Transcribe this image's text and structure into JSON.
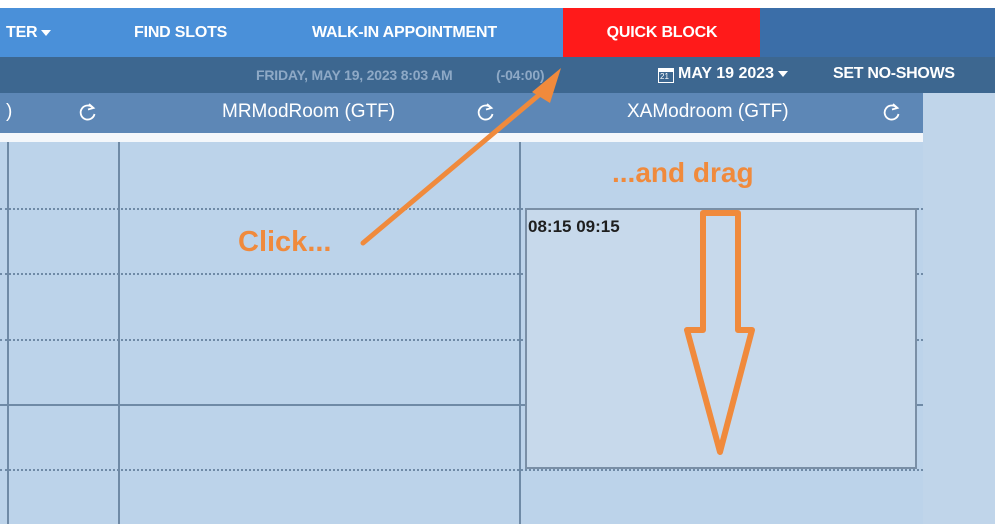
{
  "nav": {
    "filter_label": "TER",
    "find_slots": "FIND SLOTS",
    "walk_in": "WALK-IN APPOINTMENT",
    "quick_block": "QUICK BLOCK"
  },
  "subbar": {
    "current_datetime": "FRIDAY, MAY 19, 2023 8:03 AM",
    "timezone_offset": "(-04:00)",
    "calendar_icon_day": "21",
    "selected_date": "MAY 19 2023",
    "set_no_shows": "SET NO-SHOWS"
  },
  "rooms": [
    {
      "name": ")"
    },
    {
      "name": "MRModRoom (GTF)"
    },
    {
      "name": "XAModroom (GTF)"
    }
  ],
  "selection": {
    "time_range": "08:15 09:15"
  },
  "annotations": {
    "click": "Click...",
    "drag": "...and drag"
  },
  "colors": {
    "nav_bg": "#4a90d9",
    "quick_block_bg": "#ff1a1a",
    "subbar_bg": "#3d6790",
    "room_header_bg": "#5d87b6",
    "grid_bg": "#bcd3ea",
    "annotation": "#f08a3c"
  },
  "icons": [
    "caret-down-icon",
    "calendar-icon",
    "refresh-icon",
    "arrow-icon"
  ]
}
